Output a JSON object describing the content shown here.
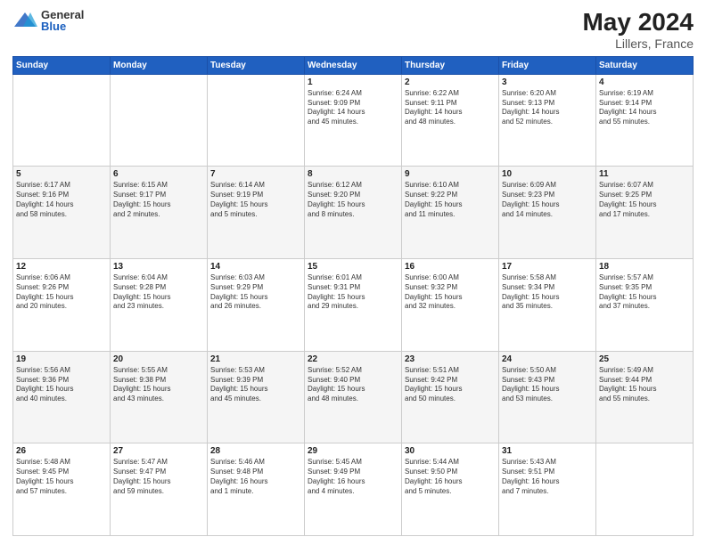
{
  "logo": {
    "general": "General",
    "blue": "Blue"
  },
  "title": "May 2024",
  "subtitle": "Lillers, France",
  "days_of_week": [
    "Sunday",
    "Monday",
    "Tuesday",
    "Wednesday",
    "Thursday",
    "Friday",
    "Saturday"
  ],
  "weeks": [
    [
      {
        "day": "",
        "info": ""
      },
      {
        "day": "",
        "info": ""
      },
      {
        "day": "",
        "info": ""
      },
      {
        "day": "1",
        "info": "Sunrise: 6:24 AM\nSunset: 9:09 PM\nDaylight: 14 hours\nand 45 minutes."
      },
      {
        "day": "2",
        "info": "Sunrise: 6:22 AM\nSunset: 9:11 PM\nDaylight: 14 hours\nand 48 minutes."
      },
      {
        "day": "3",
        "info": "Sunrise: 6:20 AM\nSunset: 9:13 PM\nDaylight: 14 hours\nand 52 minutes."
      },
      {
        "day": "4",
        "info": "Sunrise: 6:19 AM\nSunset: 9:14 PM\nDaylight: 14 hours\nand 55 minutes."
      }
    ],
    [
      {
        "day": "5",
        "info": "Sunrise: 6:17 AM\nSunset: 9:16 PM\nDaylight: 14 hours\nand 58 minutes."
      },
      {
        "day": "6",
        "info": "Sunrise: 6:15 AM\nSunset: 9:17 PM\nDaylight: 15 hours\nand 2 minutes."
      },
      {
        "day": "7",
        "info": "Sunrise: 6:14 AM\nSunset: 9:19 PM\nDaylight: 15 hours\nand 5 minutes."
      },
      {
        "day": "8",
        "info": "Sunrise: 6:12 AM\nSunset: 9:20 PM\nDaylight: 15 hours\nand 8 minutes."
      },
      {
        "day": "9",
        "info": "Sunrise: 6:10 AM\nSunset: 9:22 PM\nDaylight: 15 hours\nand 11 minutes."
      },
      {
        "day": "10",
        "info": "Sunrise: 6:09 AM\nSunset: 9:23 PM\nDaylight: 15 hours\nand 14 minutes."
      },
      {
        "day": "11",
        "info": "Sunrise: 6:07 AM\nSunset: 9:25 PM\nDaylight: 15 hours\nand 17 minutes."
      }
    ],
    [
      {
        "day": "12",
        "info": "Sunrise: 6:06 AM\nSunset: 9:26 PM\nDaylight: 15 hours\nand 20 minutes."
      },
      {
        "day": "13",
        "info": "Sunrise: 6:04 AM\nSunset: 9:28 PM\nDaylight: 15 hours\nand 23 minutes."
      },
      {
        "day": "14",
        "info": "Sunrise: 6:03 AM\nSunset: 9:29 PM\nDaylight: 15 hours\nand 26 minutes."
      },
      {
        "day": "15",
        "info": "Sunrise: 6:01 AM\nSunset: 9:31 PM\nDaylight: 15 hours\nand 29 minutes."
      },
      {
        "day": "16",
        "info": "Sunrise: 6:00 AM\nSunset: 9:32 PM\nDaylight: 15 hours\nand 32 minutes."
      },
      {
        "day": "17",
        "info": "Sunrise: 5:58 AM\nSunset: 9:34 PM\nDaylight: 15 hours\nand 35 minutes."
      },
      {
        "day": "18",
        "info": "Sunrise: 5:57 AM\nSunset: 9:35 PM\nDaylight: 15 hours\nand 37 minutes."
      }
    ],
    [
      {
        "day": "19",
        "info": "Sunrise: 5:56 AM\nSunset: 9:36 PM\nDaylight: 15 hours\nand 40 minutes."
      },
      {
        "day": "20",
        "info": "Sunrise: 5:55 AM\nSunset: 9:38 PM\nDaylight: 15 hours\nand 43 minutes."
      },
      {
        "day": "21",
        "info": "Sunrise: 5:53 AM\nSunset: 9:39 PM\nDaylight: 15 hours\nand 45 minutes."
      },
      {
        "day": "22",
        "info": "Sunrise: 5:52 AM\nSunset: 9:40 PM\nDaylight: 15 hours\nand 48 minutes."
      },
      {
        "day": "23",
        "info": "Sunrise: 5:51 AM\nSunset: 9:42 PM\nDaylight: 15 hours\nand 50 minutes."
      },
      {
        "day": "24",
        "info": "Sunrise: 5:50 AM\nSunset: 9:43 PM\nDaylight: 15 hours\nand 53 minutes."
      },
      {
        "day": "25",
        "info": "Sunrise: 5:49 AM\nSunset: 9:44 PM\nDaylight: 15 hours\nand 55 minutes."
      }
    ],
    [
      {
        "day": "26",
        "info": "Sunrise: 5:48 AM\nSunset: 9:45 PM\nDaylight: 15 hours\nand 57 minutes."
      },
      {
        "day": "27",
        "info": "Sunrise: 5:47 AM\nSunset: 9:47 PM\nDaylight: 15 hours\nand 59 minutes."
      },
      {
        "day": "28",
        "info": "Sunrise: 5:46 AM\nSunset: 9:48 PM\nDaylight: 16 hours\nand 1 minute."
      },
      {
        "day": "29",
        "info": "Sunrise: 5:45 AM\nSunset: 9:49 PM\nDaylight: 16 hours\nand 4 minutes."
      },
      {
        "day": "30",
        "info": "Sunrise: 5:44 AM\nSunset: 9:50 PM\nDaylight: 16 hours\nand 5 minutes."
      },
      {
        "day": "31",
        "info": "Sunrise: 5:43 AM\nSunset: 9:51 PM\nDaylight: 16 hours\nand 7 minutes."
      },
      {
        "day": "",
        "info": ""
      }
    ]
  ]
}
